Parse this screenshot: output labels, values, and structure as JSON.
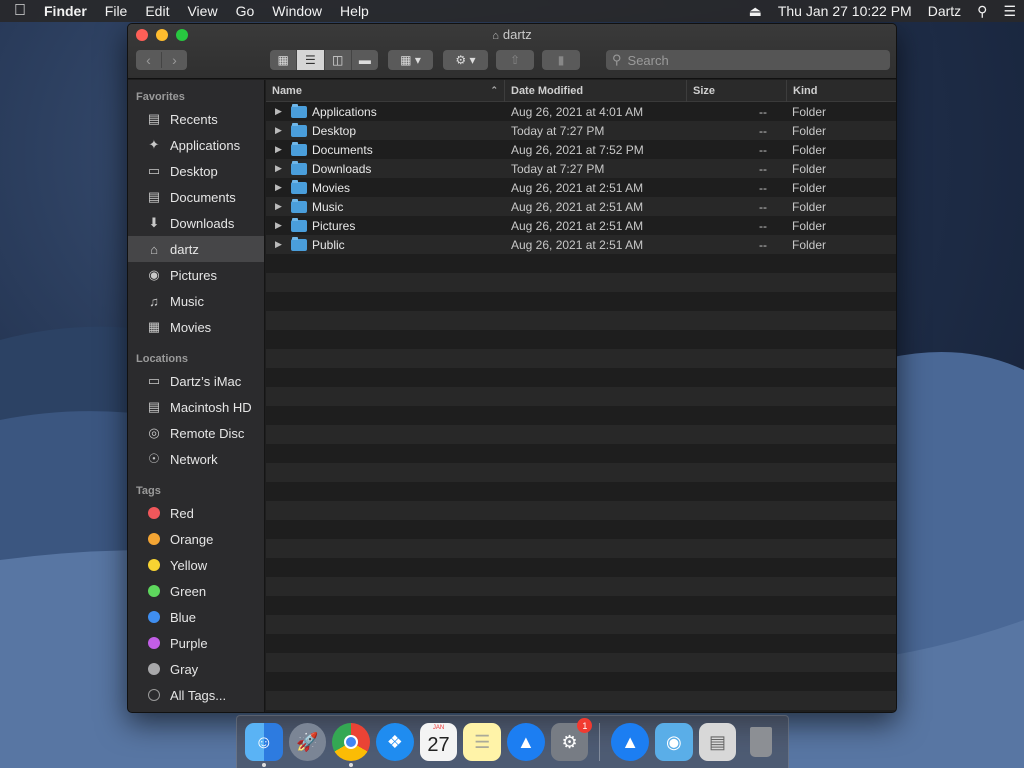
{
  "menubar": {
    "apple": "",
    "app_name": "Finder",
    "menus": [
      "File",
      "Edit",
      "View",
      "Go",
      "Window",
      "Help"
    ],
    "datetime": "Thu Jan 27  10:22 PM",
    "user": "Dartz"
  },
  "window": {
    "title": "dartz",
    "search_placeholder": "Search"
  },
  "sidebar": {
    "favorites_header": "Favorites",
    "favorites": [
      "Recents",
      "Applications",
      "Desktop",
      "Documents",
      "Downloads",
      "dartz",
      "Pictures",
      "Music",
      "Movies"
    ],
    "locations_header": "Locations",
    "locations": [
      "Dartz’s iMac",
      "Macintosh HD",
      "Remote Disc",
      "Network"
    ],
    "tags_header": "Tags",
    "tags": [
      "Red",
      "Orange",
      "Yellow",
      "Green",
      "Blue",
      "Purple",
      "Gray",
      "All Tags..."
    ],
    "tag_colors": [
      "#f0575b",
      "#f4a534",
      "#f7d332",
      "#5ed75d",
      "#3f8ef0",
      "#c25ee6",
      "#a8a8aa",
      ""
    ]
  },
  "columns": {
    "name": "Name",
    "date": "Date Modified",
    "size": "Size",
    "kind": "Kind"
  },
  "files": [
    {
      "name": "Applications",
      "date": "Aug 26, 2021 at 4:01 AM",
      "size": "--",
      "kind": "Folder"
    },
    {
      "name": "Desktop",
      "date": "Today at 7:27 PM",
      "size": "--",
      "kind": "Folder"
    },
    {
      "name": "Documents",
      "date": "Aug 26, 2021 at 7:52 PM",
      "size": "--",
      "kind": "Folder"
    },
    {
      "name": "Downloads",
      "date": "Today at 7:27 PM",
      "size": "--",
      "kind": "Folder"
    },
    {
      "name": "Movies",
      "date": "Aug 26, 2021 at 2:51 AM",
      "size": "--",
      "kind": "Folder"
    },
    {
      "name": "Music",
      "date": "Aug 26, 2021 at 2:51 AM",
      "size": "--",
      "kind": "Folder"
    },
    {
      "name": "Pictures",
      "date": "Aug 26, 2021 at 2:51 AM",
      "size": "--",
      "kind": "Folder"
    },
    {
      "name": "Public",
      "date": "Aug 26, 2021 at 2:51 AM",
      "size": "--",
      "kind": "Folder"
    }
  ],
  "dock": {
    "calendar_month": "JAN",
    "calendar_day": "27",
    "system_prefs_badge": "1"
  }
}
